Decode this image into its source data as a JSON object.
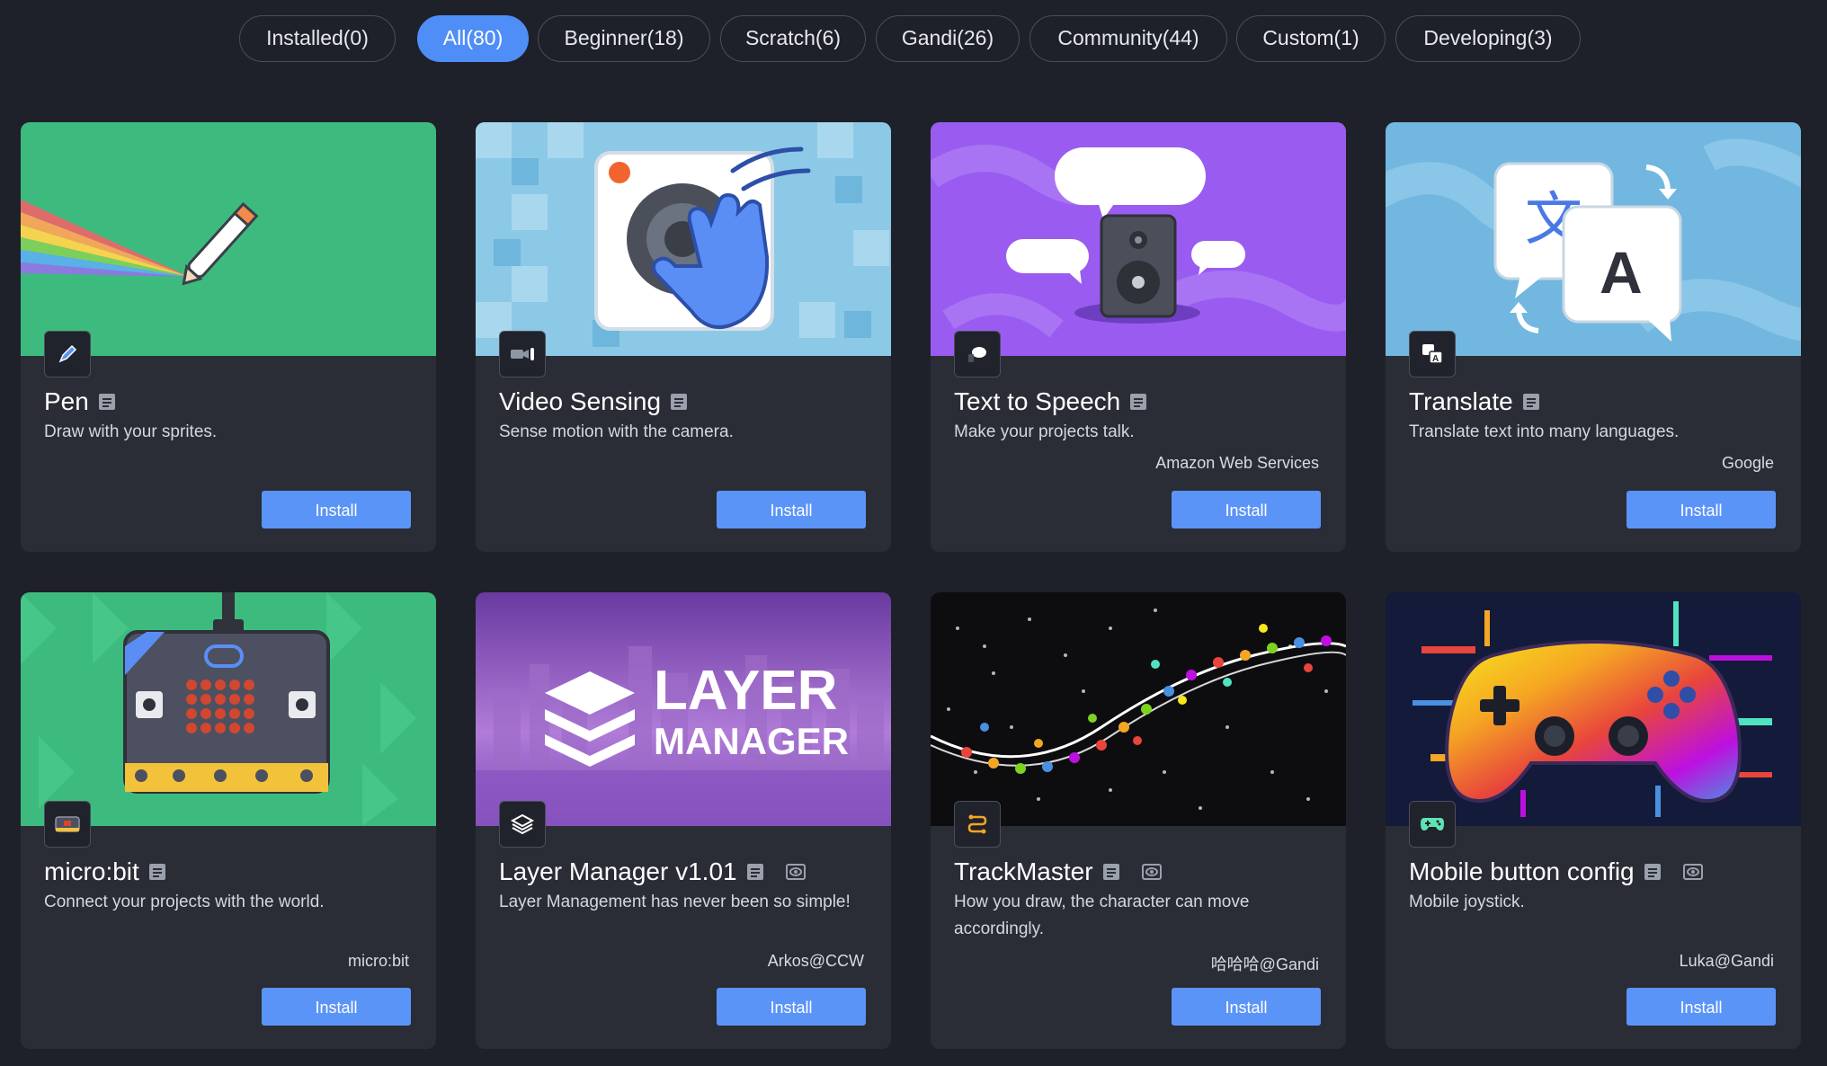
{
  "filters": {
    "tabs": [
      {
        "label": "Installed(0)"
      },
      {
        "label": "All(80)"
      },
      {
        "label": "Beginner(18)"
      },
      {
        "label": "Scratch(6)"
      },
      {
        "label": "Gandi(26)"
      },
      {
        "label": "Community(44)"
      },
      {
        "label": "Custom(1)"
      },
      {
        "label": "Developing(3)"
      }
    ],
    "active": "All(80)"
  },
  "cards": [
    {
      "title": "Pen",
      "description": "Draw with your sprites.",
      "author": "",
      "install_label": "Install",
      "icon": "pen-icon",
      "doc_icon": "doc-icon"
    },
    {
      "title": "Video Sensing",
      "description": "Sense motion with the camera.",
      "author": "",
      "install_label": "Install",
      "icon": "video-sensing-icon",
      "doc_icon": "doc-icon"
    },
    {
      "title": "Text to Speech",
      "description": "Make your projects talk.",
      "author": "Amazon Web Services",
      "install_label": "Install",
      "icon": "speech-bubble-icon",
      "doc_icon": "doc-icon"
    },
    {
      "title": "Translate",
      "description": "Translate text into many languages.",
      "author": "Google",
      "install_label": "Install",
      "icon": "translate-icon",
      "doc_icon": "doc-icon"
    },
    {
      "title": "micro:bit",
      "description": "Connect your projects with the world.",
      "author": "micro:bit",
      "install_label": "Install",
      "icon": "microbit-icon",
      "doc_icon": "doc-icon"
    },
    {
      "title": "Layer Manager v1.01",
      "description": "Layer Management has never been so simple!",
      "author": "Arkos@CCW",
      "install_label": "Install",
      "icon": "layers-icon",
      "doc_icon": "doc-icon",
      "preview_icon": "eye-icon",
      "banner_line1": "LAYER",
      "banner_line2": "MANAGER"
    },
    {
      "title": "TrackMaster",
      "description": "How you draw, the character can move accordingly.",
      "author": "哈哈哈@Gandi",
      "install_label": "Install",
      "icon": "track-icon",
      "doc_icon": "doc-icon",
      "preview_icon": "eye-icon"
    },
    {
      "title": "Mobile button config",
      "description": "Mobile joystick.",
      "author": "Luka@Gandi",
      "install_label": "Install",
      "icon": "gamepad-icon",
      "doc_icon": "doc-icon",
      "preview_icon": "eye-icon"
    }
  ],
  "colors": {
    "background": "#1e2129",
    "card": "#2a2d36",
    "accent": "#4f8ef7",
    "install_button": "#5b94f7"
  }
}
